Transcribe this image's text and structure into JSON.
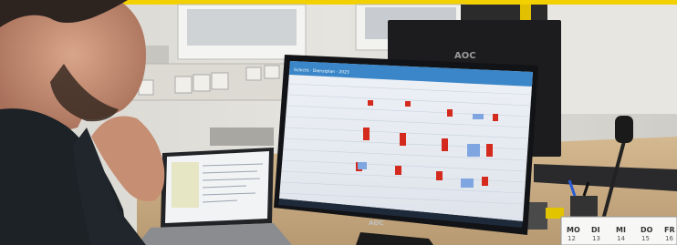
{
  "photo": {
    "top_stripe_color": "#f3d000",
    "monitor_brand": "AOC",
    "background_monitor_brand": "AOC",
    "calendar_days": [
      "MO",
      "DI",
      "MI",
      "DO",
      "FR"
    ],
    "calendar_dates": [
      "12",
      "13",
      "14",
      "15",
      "16"
    ],
    "spreadsheet_title": "Schicht · Dienstplan · 2023",
    "spreadsheet_highlight_colors": [
      "#d42a1e",
      "#7fa6e0"
    ]
  }
}
